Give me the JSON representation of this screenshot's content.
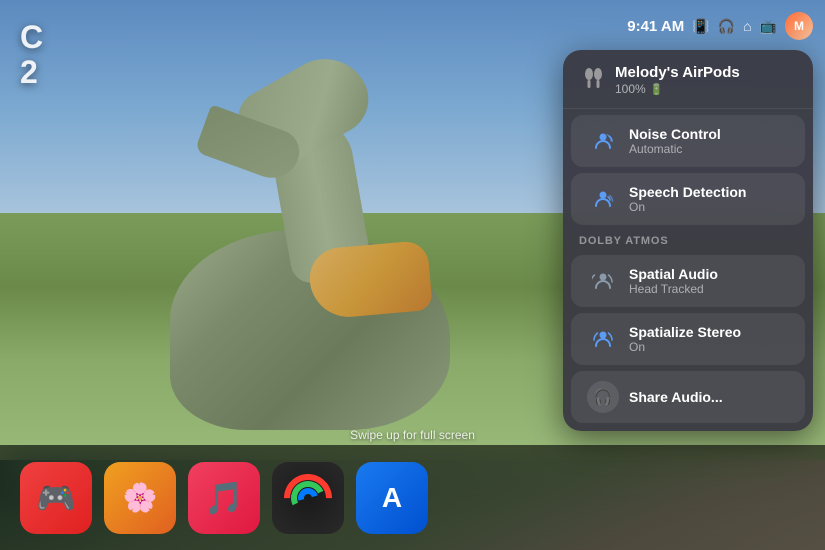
{
  "corner_text": {
    "line1": "C",
    "line2": "2"
  },
  "swipe_hint": "Swipe up for full screen",
  "statusbar": {
    "time": "9:41 AM",
    "battery_icon": "🔋",
    "home_icon": "🏠",
    "cast_icon": "📺"
  },
  "airpods_panel": {
    "device_name": "Melody's AirPods",
    "battery": "100%",
    "items": [
      {
        "id": "noise-control",
        "title": "Noise Control",
        "subtitle": "Automatic",
        "icon_type": "person-wave"
      },
      {
        "id": "speech-detection",
        "title": "Speech Detection",
        "subtitle": "On",
        "icon_type": "person-wave2"
      }
    ],
    "dolby_section": "DOLBY ATMOS",
    "dolby_items": [
      {
        "id": "spatial-audio",
        "title": "Spatial Audio",
        "subtitle": "Head Tracked",
        "icon_type": "person-spatial"
      },
      {
        "id": "spatialize-stereo",
        "title": "Spatialize Stereo",
        "subtitle": "On",
        "icon_type": "person-stereo"
      }
    ],
    "share_audio": "Share Audio..."
  },
  "dock": {
    "items": [
      {
        "id": "arcade",
        "label": "Arcade",
        "icon": "🎮"
      },
      {
        "id": "photos",
        "label": "Photos",
        "icon": "🌸"
      },
      {
        "id": "music",
        "label": "Music",
        "icon": "🎵"
      },
      {
        "id": "fitness",
        "label": "Fitness",
        "icon": "rings"
      },
      {
        "id": "appstore",
        "label": "App Store",
        "icon": "A"
      }
    ]
  },
  "colors": {
    "accent_blue": "#5b9cf6",
    "panel_bg": "rgba(58,58,68,0.96)",
    "item_bg": "rgba(255,255,255,0.07)"
  }
}
